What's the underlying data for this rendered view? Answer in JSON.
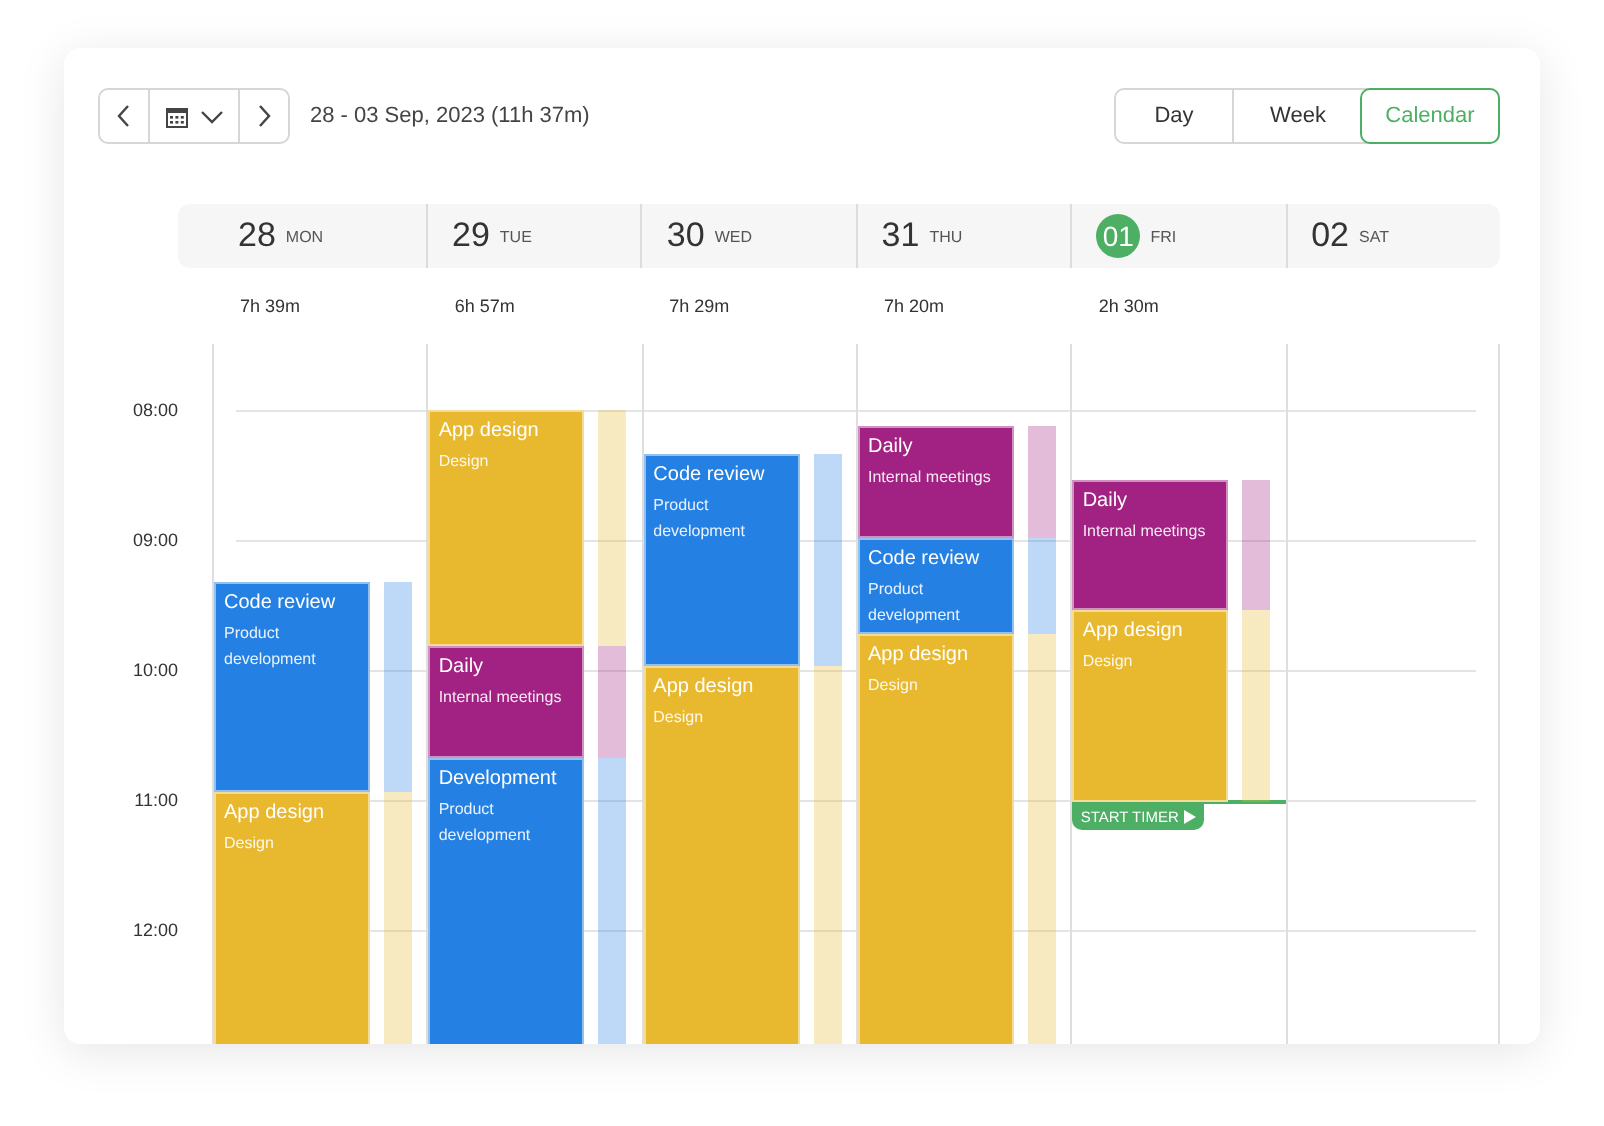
{
  "toolbar": {
    "range": "28 - 03 Sep, 2023 (11h 37m)"
  },
  "views": [
    {
      "label": "Day",
      "selected": false
    },
    {
      "label": "Week",
      "selected": false
    },
    {
      "label": "Calendar",
      "selected": true
    }
  ],
  "hours": [
    "08:00",
    "09:00",
    "10:00",
    "11:00",
    "12:00"
  ],
  "days": [
    {
      "date": "28",
      "weekday": "MON",
      "today": false,
      "total": "7h 39m",
      "segments": [
        {
          "kind": "event",
          "title": "Code review",
          "subtitle": "Product development",
          "color": "#2580e3"
        },
        {
          "kind": "event",
          "title": "App design",
          "subtitle": "Design",
          "color": "#e8b92f"
        }
      ]
    },
    {
      "date": "29",
      "weekday": "TUE",
      "today": false,
      "total": "6h 57m",
      "segments": [
        {
          "kind": "event",
          "title": "App design",
          "subtitle": "Design",
          "color": "#e8b92f"
        },
        {
          "kind": "event",
          "title": "Daily",
          "subtitle": "Internal meetings",
          "color": "#a12283"
        },
        {
          "kind": "event",
          "title": "Development",
          "subtitle": "Product development",
          "color": "#2580e3"
        }
      ]
    },
    {
      "date": "30",
      "weekday": "WED",
      "today": false,
      "total": "7h 29m",
      "segments": [
        {
          "kind": "event",
          "title": "Code review",
          "subtitle": "Product development",
          "color": "#2580e3"
        },
        {
          "kind": "event",
          "title": "App design",
          "subtitle": "Design",
          "color": "#e8b92f"
        }
      ]
    },
    {
      "date": "31",
      "weekday": "THU",
      "today": false,
      "total": "7h 20m",
      "segments": [
        {
          "kind": "event",
          "title": "Daily",
          "subtitle": "Internal meetings",
          "color": "#a12283"
        },
        {
          "kind": "event",
          "title": "Code review",
          "subtitle": "Product development",
          "color": "#2580e3"
        },
        {
          "kind": "event",
          "title": "App design",
          "subtitle": "Design",
          "color": "#e8b92f"
        }
      ]
    },
    {
      "date": "01",
      "weekday": "FRI",
      "today": true,
      "total": "2h 30m",
      "segments": [
        {
          "kind": "event",
          "title": "Daily",
          "subtitle": "Internal meetings",
          "color": "#a12283"
        },
        {
          "kind": "event",
          "title": "App design",
          "subtitle": "Design",
          "color": "#e8b92f"
        },
        {
          "kind": "timer",
          "label": "START TIMER"
        }
      ]
    },
    {
      "date": "02",
      "weekday": "SAT",
      "today": false
    }
  ]
}
